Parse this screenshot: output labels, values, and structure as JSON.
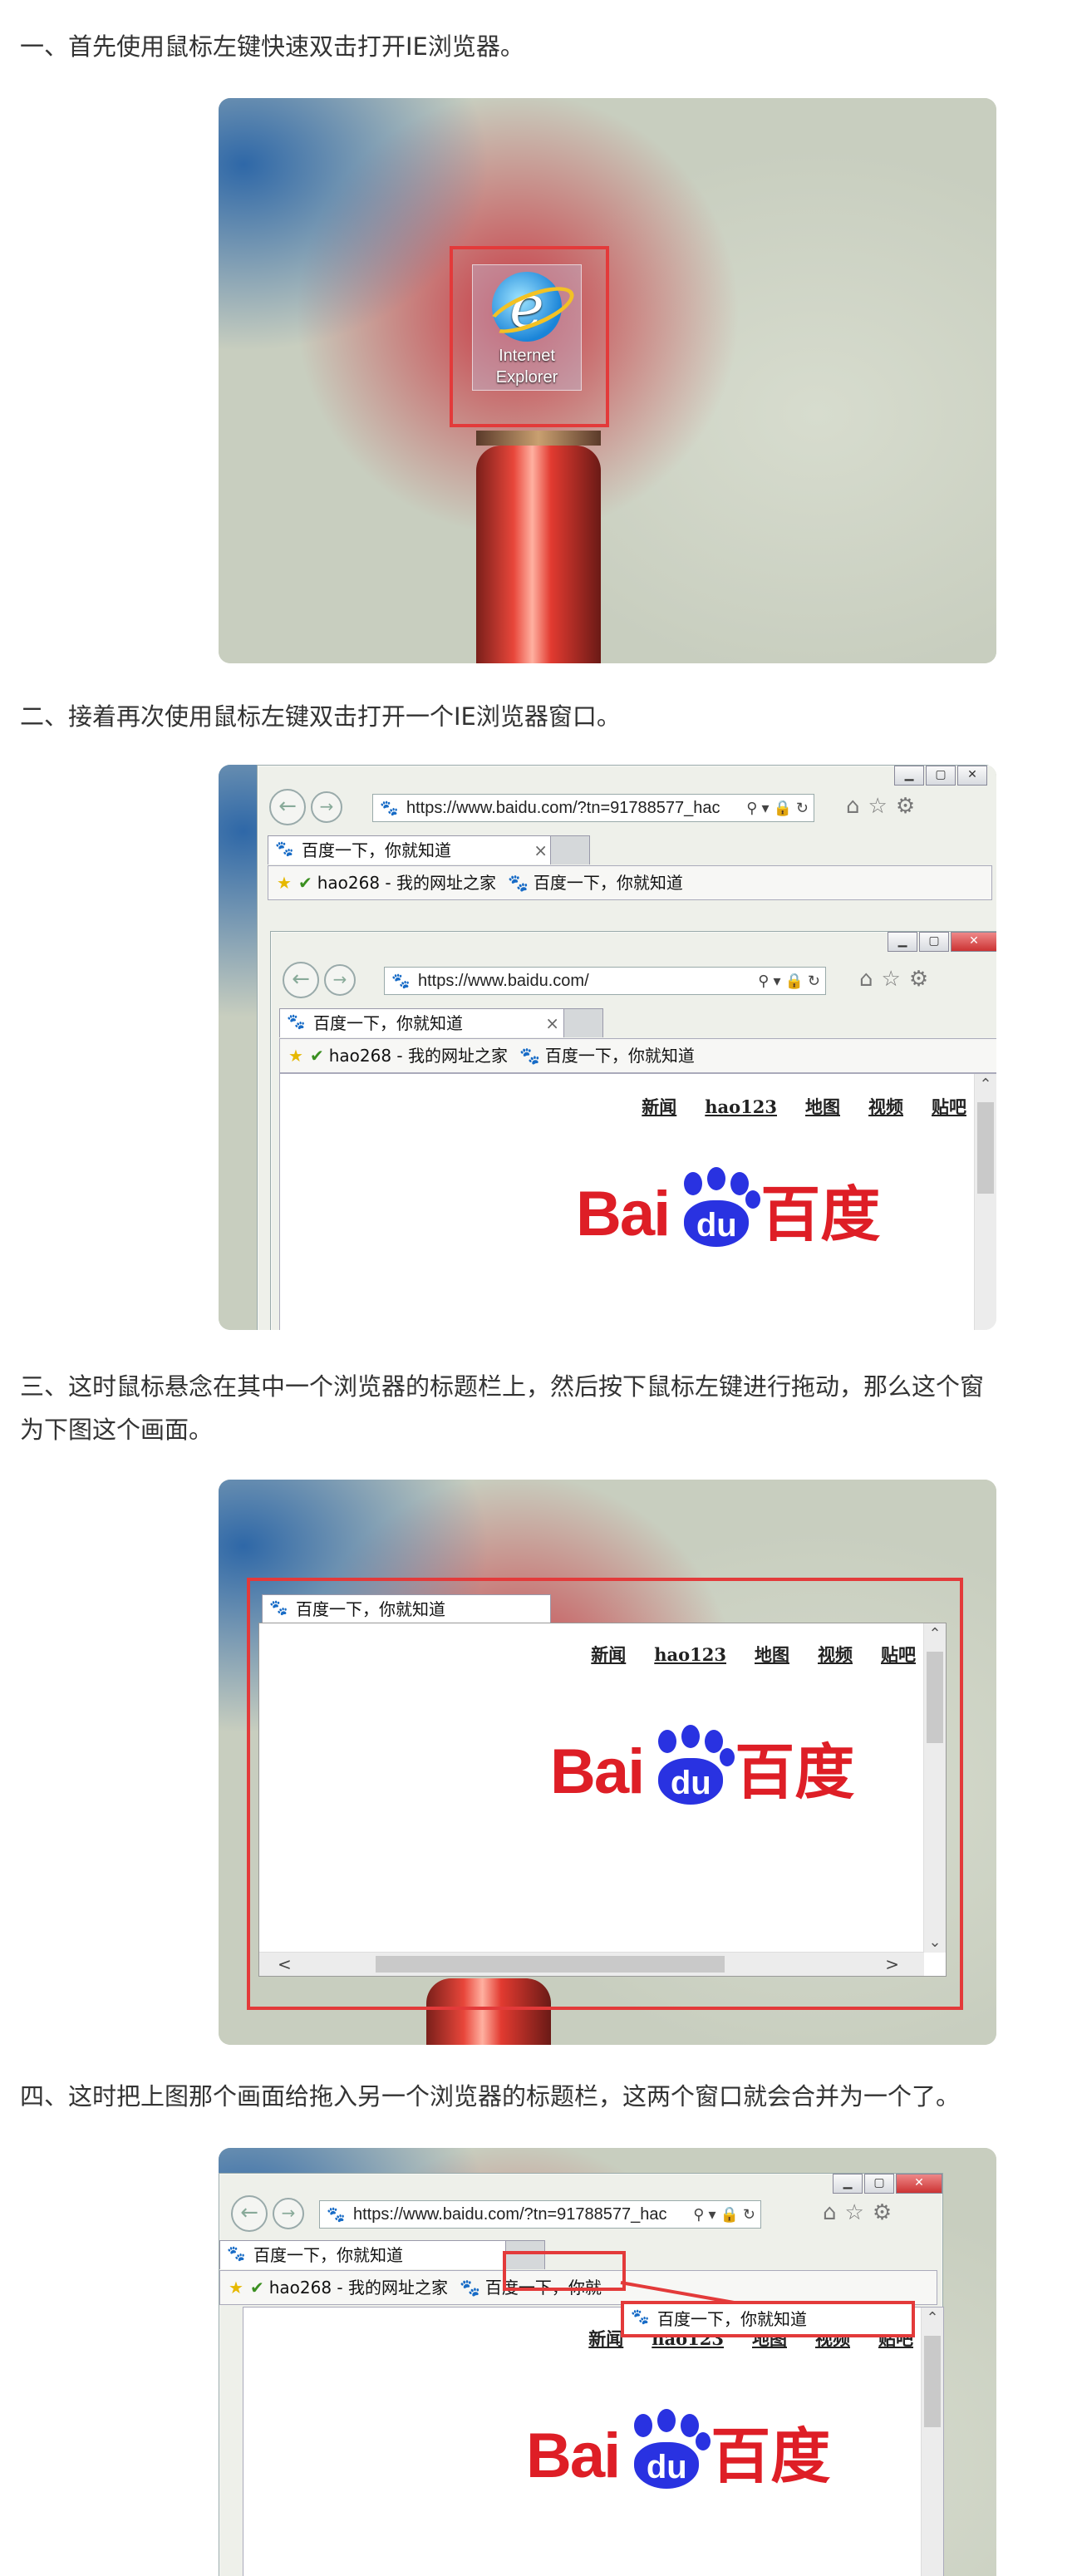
{
  "steps": [
    {
      "text": "一、首先使用鼠标左键快速双击打开IE浏览器。"
    },
    {
      "text": "二、接着再次使用鼠标左键双击打开一个IE浏览器窗口。"
    },
    {
      "text": "三、这时鼠标悬念在其中一个浏览器的标题栏上，然后按下鼠标左键进行拖动，那么这个窗",
      "text2": "为下图这个画面。"
    },
    {
      "text": "四、这时把上图那个画面给拖入另一个浏览器的标题栏，这两个窗口就会合并为一个了。"
    }
  ],
  "ie_icon": {
    "line1": "Internet",
    "line2": "Explorer"
  },
  "browser": {
    "url_full": "https://www.baidu.com/?tn=91788577_hac",
    "url_short": "https://www.baidu.com/",
    "tab_title": "百度一下，你就知道",
    "tab_close": "×",
    "fav_hao": "hao268 - 我的网址之家",
    "fav_baidu": "百度一下，你就知道",
    "fav_baidu_cut": "百度一下，你就",
    "addr_tools": "⚲ ▾ 🔒 ↻",
    "tool_icons": "⌂☆⚙",
    "back": "←",
    "fwd": "→",
    "win_min": "▁",
    "win_max": "▢",
    "win_close": "✕"
  },
  "baidu_page": {
    "links": [
      "新闻",
      "hao123",
      "地图",
      "视频",
      "贴吧"
    ],
    "logo_bai": "Bai",
    "logo_du": "du",
    "logo_cn": "百度"
  },
  "scroll": {
    "up": "⌃",
    "down": "⌄",
    "left": "<",
    "right": ">"
  }
}
